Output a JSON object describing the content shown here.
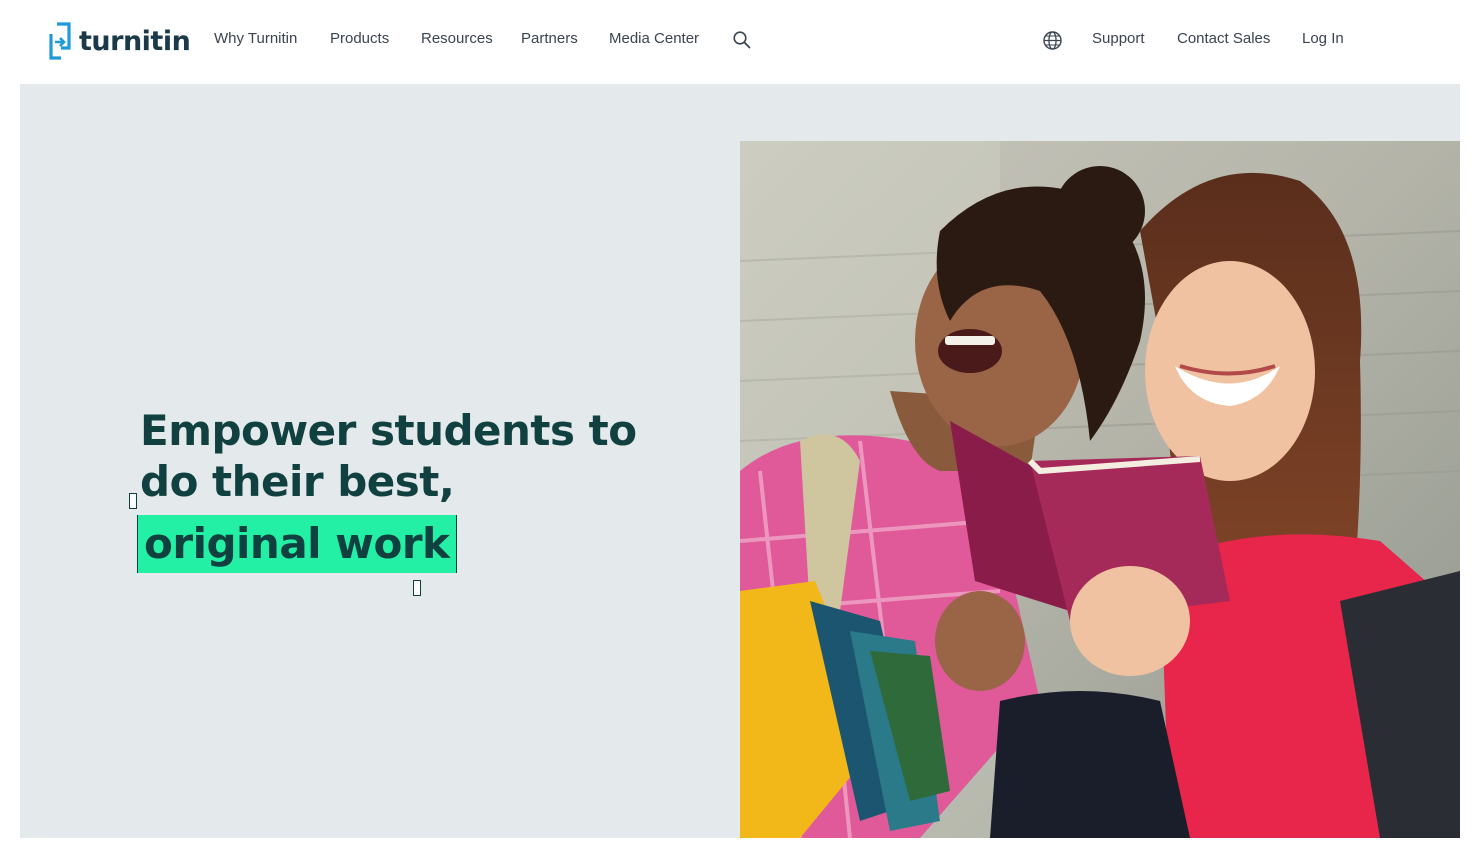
{
  "brand": {
    "name": "turnitin",
    "icon": "turnitin-logo-icon",
    "color": "#1a3a4a",
    "accent": "#1e9bd7"
  },
  "nav": {
    "items": [
      "Why Turnitin",
      "Products",
      "Resources",
      "Partners",
      "Media Center"
    ],
    "search_icon": "search-icon",
    "globe_icon": "globe-icon",
    "right_items": [
      "Support",
      "Contact Sales",
      "Log In"
    ]
  },
  "hero": {
    "line1": "Empower students to",
    "line2": "do their best,",
    "highlight": "original work",
    "highlight_color": "#23f0a4",
    "background": "#e4e9ec",
    "image": "two-students-laughing-reading-book-photo"
  }
}
